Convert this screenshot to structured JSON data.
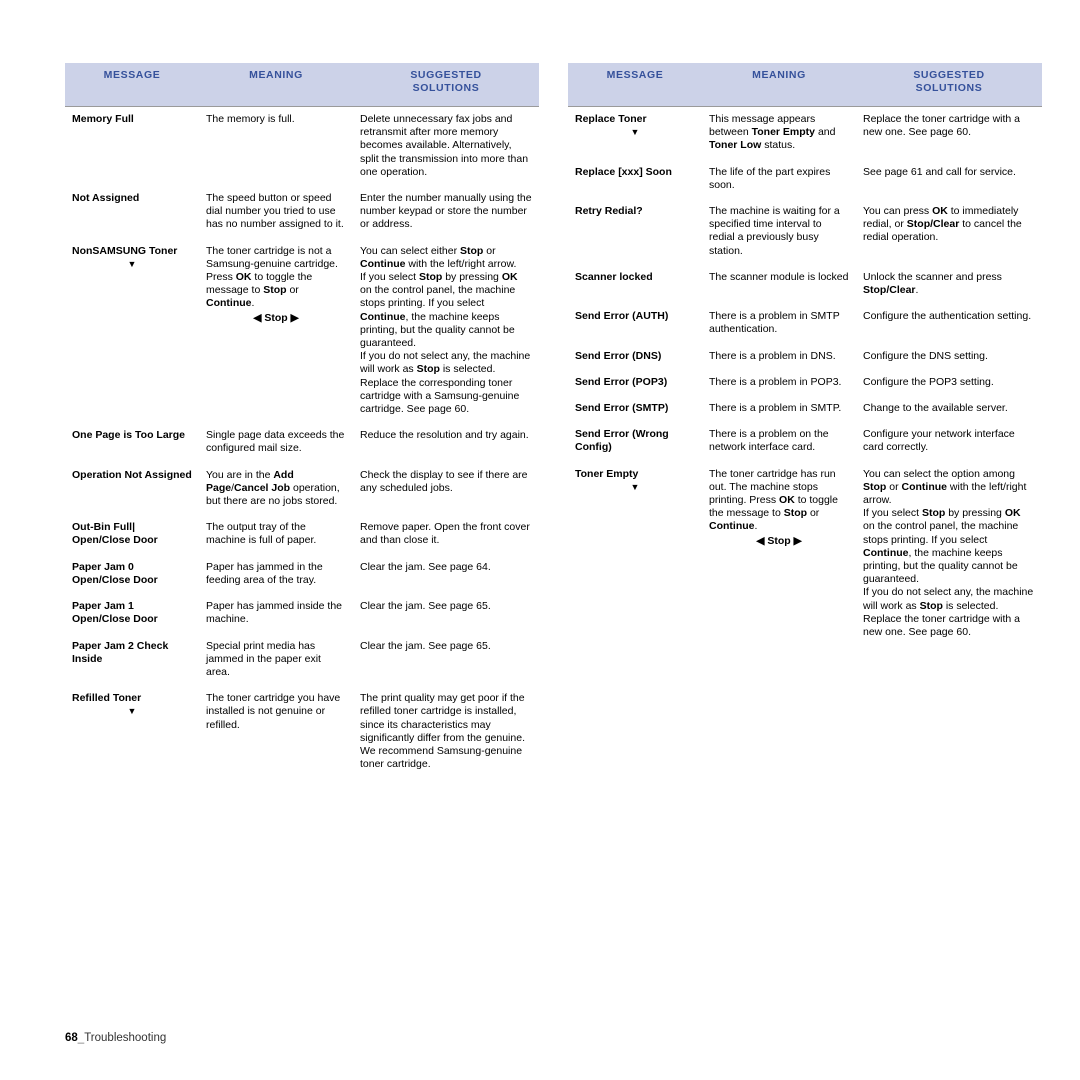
{
  "headers": {
    "message": "MESSAGE",
    "meaning": "MEANING",
    "solutions_line1": "SUGGESTED",
    "solutions_line2": "SOLUTIONS"
  },
  "footer": {
    "page_number": "68",
    "separator": "_",
    "section": "Troubleshooting"
  },
  "left_table": {
    "rows": [
      {
        "message": "Memory Full",
        "meaning": "The memory is full.",
        "solution": "Delete unnecessary fax jobs and retransmit after more memory becomes available. Alternatively, split the transmission into more than one operation."
      },
      {
        "message": "Not Assigned",
        "meaning": "The speed button or speed dial number you tried to use has no number assigned to it.",
        "solution": "Enter the number manually using the number keypad or store the number or address."
      },
      {
        "message": "NonSAMSUNG Toner",
        "message_arrow": "▼",
        "meaning_parts": [
          {
            "t": "The toner cartridge is not a Samsung-genuine cartridge. Press ",
            "b": false
          },
          {
            "t": "OK",
            "b": true
          },
          {
            "t": " to toggle the message to ",
            "b": false
          },
          {
            "t": "Stop",
            "b": true
          },
          {
            "t": " or ",
            "b": false
          },
          {
            "t": "Continue",
            "b": true
          },
          {
            "t": ".",
            "b": false
          }
        ],
        "meaning_stop": "◀ Stop ▶",
        "solution_parts": [
          {
            "t": "You can select either ",
            "b": false
          },
          {
            "t": "Stop",
            "b": true
          },
          {
            "t": " or ",
            "b": false
          },
          {
            "t": "Continue",
            "b": true
          },
          {
            "t": " with the left/right arrow.",
            "b": false
          },
          {
            "t": "\nIf you select ",
            "b": false
          },
          {
            "t": "Stop",
            "b": true
          },
          {
            "t": " by pressing ",
            "b": false
          },
          {
            "t": "OK",
            "b": true
          },
          {
            "t": " on the control panel, the machine stops printing. If you select ",
            "b": false
          },
          {
            "t": "Continue",
            "b": true
          },
          {
            "t": ", the machine keeps printing, but the quality cannot be guaranteed.",
            "b": false
          },
          {
            "t": "\nIf you do not select any, the machine will work as ",
            "b": false
          },
          {
            "t": "Stop",
            "b": true
          },
          {
            "t": " is selected. Replace the corresponding toner cartridge with a Samsung-genuine cartridge. See page 60.",
            "b": false
          }
        ]
      },
      {
        "message": "One Page is Too Large",
        "meaning": "Single page data exceeds the configured mail size.",
        "solution": "Reduce the resolution and try again."
      },
      {
        "message": "Operation Not Assigned",
        "meaning_parts": [
          {
            "t": "You are in the ",
            "b": false
          },
          {
            "t": "Add Page",
            "b": true
          },
          {
            "t": "/",
            "b": false
          },
          {
            "t": "Cancel Job",
            "b": true
          },
          {
            "t": " operation, but there are no jobs stored.",
            "b": false
          }
        ],
        "solution": "Check the display to see if there are any scheduled jobs."
      },
      {
        "message": "Out-Bin Full| Open/Close Door",
        "meaning": "The output tray of the machine is full of paper.",
        "solution": "Remove paper. Open the front cover and than close it."
      },
      {
        "message": "Paper Jam 0 Open/Close Door",
        "meaning": "Paper has jammed in the feeding area of the tray.",
        "solution": "Clear the jam. See page 64."
      },
      {
        "message": "Paper Jam 1 Open/Close Door",
        "meaning": "Paper has jammed inside the machine.",
        "solution": "Clear the jam. See page 65."
      },
      {
        "message": "Paper Jam 2 Check Inside",
        "meaning": "Special print media has jammed in the paper exit area.",
        "solution": "Clear the jam. See page 65."
      },
      {
        "message": "Refilled Toner",
        "message_arrow": "▼",
        "meaning": "The toner cartridge you have installed is not genuine or refilled.",
        "solution": "The print quality may get poor if the refilled toner cartridge is installed, since its characteristics may significantly differ from the genuine.\nWe recommend Samsung-genuine toner cartridge."
      }
    ]
  },
  "right_table": {
    "rows": [
      {
        "message": "Replace Toner",
        "message_arrow": "▼",
        "meaning_parts": [
          {
            "t": "This message appears between ",
            "b": false
          },
          {
            "t": "Toner Empty",
            "b": true
          },
          {
            "t": " and ",
            "b": false
          },
          {
            "t": "Toner Low",
            "b": true
          },
          {
            "t": " status.",
            "b": false
          }
        ],
        "solution": "Replace the toner cartridge with a new one. See page 60."
      },
      {
        "message": "Replace [xxx] Soon",
        "meaning": "The life of the part expires soon.",
        "solution": "See page 61 and call for service."
      },
      {
        "message": "Retry Redial?",
        "meaning": "The machine is waiting for a specified time interval to redial a previously busy station.",
        "solution_parts": [
          {
            "t": "You can press ",
            "b": false
          },
          {
            "t": "OK",
            "b": true
          },
          {
            "t": " to immediately redial, or ",
            "b": false
          },
          {
            "t": "Stop/Clear",
            "b": true
          },
          {
            "t": " to cancel the redial operation.",
            "b": false
          }
        ]
      },
      {
        "message": "Scanner locked",
        "meaning": "The scanner module is locked",
        "solution_parts": [
          {
            "t": "Unlock the scanner and press ",
            "b": false
          },
          {
            "t": "Stop/Clear",
            "b": true
          },
          {
            "t": ".",
            "b": false
          }
        ]
      },
      {
        "message": "Send Error (AUTH)",
        "meaning": "There is a problem in SMTP authentication.",
        "solution": "Configure the authentication setting."
      },
      {
        "message": "Send Error (DNS)",
        "meaning": "There is a problem in DNS.",
        "solution": "Configure the DNS setting."
      },
      {
        "message": "Send Error (POP3)",
        "meaning": "There is a problem in POP3.",
        "solution": "Configure the POP3 setting."
      },
      {
        "message": "Send Error (SMTP)",
        "meaning": "There is a problem in SMTP.",
        "solution": "Change to the available server."
      },
      {
        "message": "Send Error (Wrong Config)",
        "meaning": "There is a problem on the network interface card.",
        "solution": "Configure your network interface card correctly."
      },
      {
        "message": "Toner Empty",
        "message_arrow": "▼",
        "meaning_parts": [
          {
            "t": "The toner cartridge has run out. The machine stops printing. Press ",
            "b": false
          },
          {
            "t": "OK",
            "b": true
          },
          {
            "t": " to toggle the message to ",
            "b": false
          },
          {
            "t": "Stop",
            "b": true
          },
          {
            "t": " or ",
            "b": false
          },
          {
            "t": "Continue",
            "b": true
          },
          {
            "t": ".",
            "b": false
          }
        ],
        "meaning_stop": "◀ Stop ▶",
        "solution_parts": [
          {
            "t": "You can select the option among ",
            "b": false
          },
          {
            "t": "Stop",
            "b": true
          },
          {
            "t": " or ",
            "b": false
          },
          {
            "t": "Continue",
            "b": true
          },
          {
            "t": " with the left/right arrow.",
            "b": false
          },
          {
            "t": "\nIf you select ",
            "b": false
          },
          {
            "t": "Stop",
            "b": true
          },
          {
            "t": " by pressing ",
            "b": false
          },
          {
            "t": "OK",
            "b": true
          },
          {
            "t": " on the control panel, the machine stops printing. If you select ",
            "b": false
          },
          {
            "t": "Continue",
            "b": true
          },
          {
            "t": ", the machine keeps printing, but the quality cannot be guaranteed.",
            "b": false
          },
          {
            "t": "\nIf you do not select any, the machine will work as ",
            "b": false
          },
          {
            "t": "Stop",
            "b": true
          },
          {
            "t": " is selected. Replace the toner cartridge with a new one. See page 60.",
            "b": false
          }
        ]
      }
    ]
  }
}
